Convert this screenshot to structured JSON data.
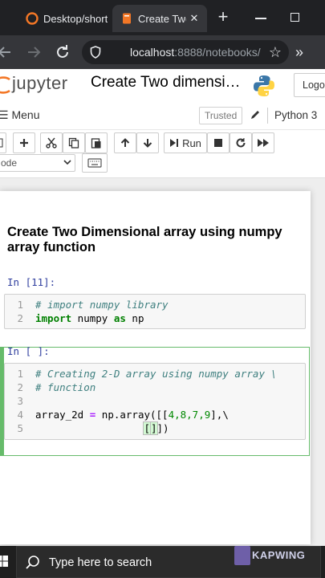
{
  "browser": {
    "tabs": [
      {
        "label": "Desktop/short",
        "active": false
      },
      {
        "label": "Create Two",
        "active": true
      }
    ],
    "close_glyph": "✕",
    "new_tab_glyph": "+",
    "address": {
      "host": "localhost",
      "rest": ":8888/notebooks/"
    }
  },
  "jupyter": {
    "logo_text": "jupyter",
    "notebook_title": "Create Two dimensi…",
    "logout_label": "Logo",
    "menu_label": "Menu",
    "trusted_label": "Trusted",
    "kernel_label": "Python 3",
    "run_label": "Run",
    "cell_type": "ode"
  },
  "notebook": {
    "heading": "Create Two Dimensional array using numpy array function",
    "cells": [
      {
        "prompt": "In [11]:",
        "lines": [
          {
            "num": "1",
            "text": "# import numpy library"
          },
          {
            "num": "2",
            "kw1": "import",
            "mid": " numpy ",
            "kw2": "as",
            "tail": " np"
          }
        ]
      },
      {
        "prompt": "In [ ]:",
        "lines": [
          {
            "num": "1",
            "text": "# Creating 2-D array using numpy array \\"
          },
          {
            "num": "2",
            "text": "# function"
          },
          {
            "num": "3",
            "text": ""
          },
          {
            "num": "4",
            "var": "array_2d ",
            "op": "=",
            "call": " np.array([[",
            "nums": "4,8,7,9",
            "end": "],\\"
          },
          {
            "num": "5",
            "pad": "                  ",
            "open": "[",
            "close": "]",
            "end": "])"
          }
        ]
      }
    ]
  },
  "taskbar": {
    "search_placeholder": "Type here to search",
    "watermark": "KAPWING"
  },
  "colors": {
    "selected_cell_border": "#66bb6a",
    "prompt_color": "#303f9f",
    "comment_color": "#408080",
    "keyword_color": "#008000"
  }
}
